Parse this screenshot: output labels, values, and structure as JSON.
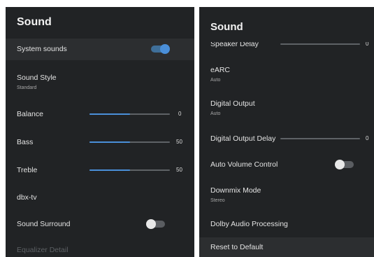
{
  "left": {
    "title": "Sound",
    "system_sounds": {
      "label": "System sounds",
      "enabled": true
    },
    "sound_style": {
      "label": "Sound Style",
      "value": "Standard"
    },
    "balance": {
      "label": "Balance",
      "value": "0",
      "fill": 0.5
    },
    "bass": {
      "label": "Bass",
      "value": "50",
      "fill": 0.5
    },
    "treble": {
      "label": "Treble",
      "value": "50",
      "fill": 0.5
    },
    "dbx_tv": {
      "label": "dbx-tv"
    },
    "sound_surround": {
      "label": "Sound Surround",
      "enabled": false
    },
    "equalizer_detail": {
      "label": "Equalizer Detail"
    }
  },
  "right": {
    "title": "Sound",
    "speaker_delay": {
      "label": "Speaker Delay",
      "value": "0"
    },
    "earc": {
      "label": "eARC",
      "value": "Auto"
    },
    "digital_output": {
      "label": "Digital Output",
      "value": "Auto"
    },
    "digital_output_delay": {
      "label": "Digital Output Delay",
      "value": "0",
      "fill": 0
    },
    "auto_volume_control": {
      "label": "Auto Volume Control",
      "enabled": false
    },
    "downmix_mode": {
      "label": "Downmix Mode",
      "value": "Stereo"
    },
    "dolby_audio_processing": {
      "label": "Dolby Audio Processing"
    },
    "reset_to_default": {
      "label": "Reset to Default"
    }
  },
  "colors": {
    "background": "#212325",
    "highlight": "#2c2e30",
    "accent": "#4a8fd9"
  }
}
